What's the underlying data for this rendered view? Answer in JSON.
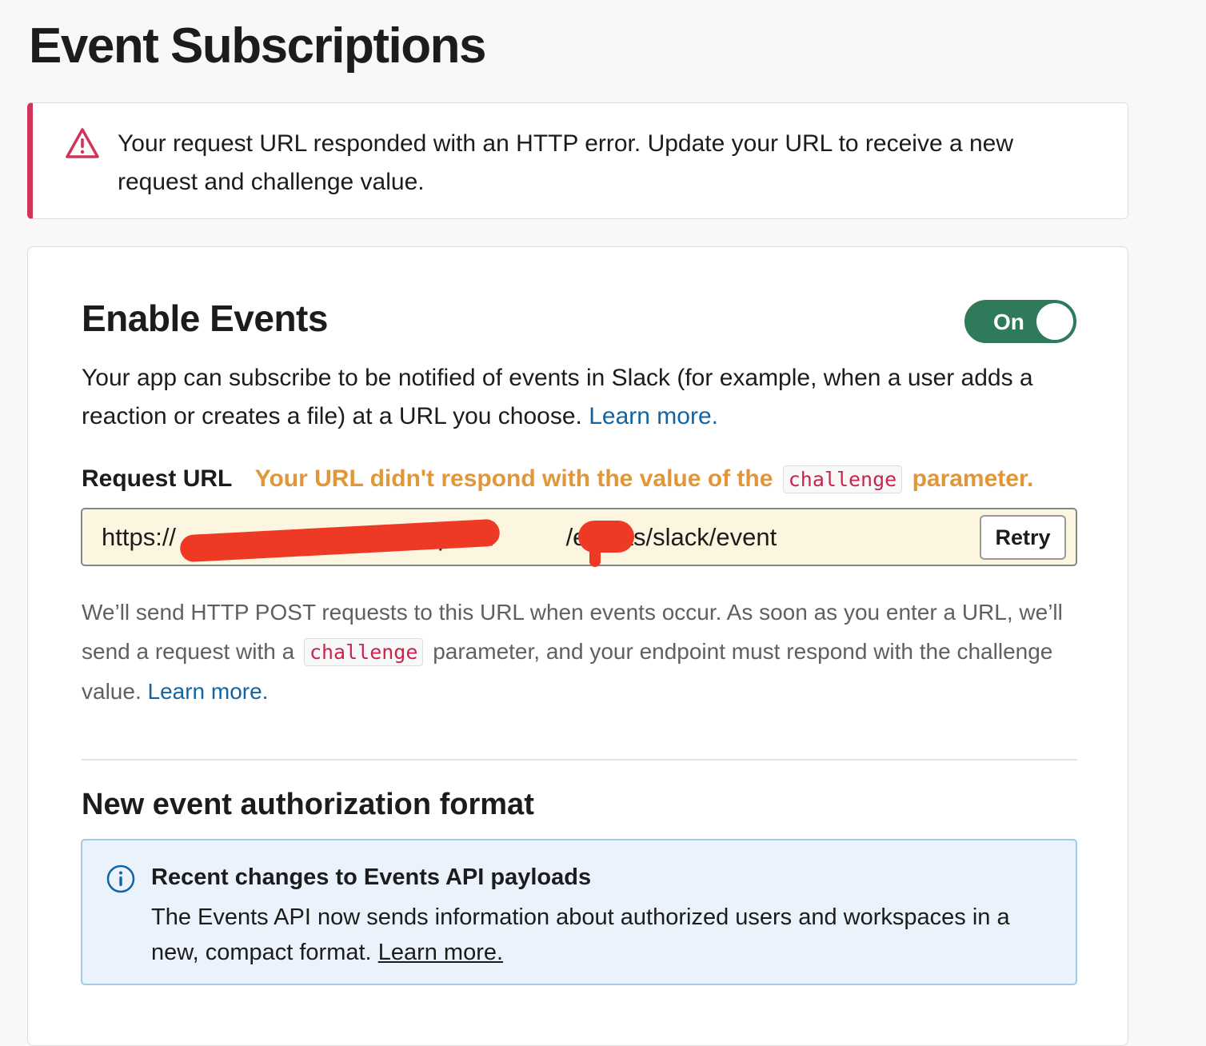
{
  "page": {
    "title": "Event Subscriptions"
  },
  "alert": {
    "icon": "warning-triangle-icon",
    "message": "Your request URL responded with an HTTP error. Update your URL to receive a new request and challenge value.",
    "color": "#d1345b"
  },
  "enable_events": {
    "title": "Enable Events",
    "toggle_label": "On",
    "toggle_state": "on",
    "description": "Your app can subscribe to be notified of events in Slack (for example, when a user adds a reaction or creates a file) at a URL you choose.",
    "learn_more": "Learn more.",
    "accent_color": "#2f7a5b"
  },
  "request_url": {
    "label": "Request URL",
    "error_prefix": "Your URL didn't respond with the value of the",
    "error_code": "challenge",
    "error_suffix": "parameter.",
    "value": "https://                                   /api/v1/          /events/slack/event",
    "retry_label": "Retry",
    "help_prefix": "We’ll send HTTP POST requests to this URL when events occur. As soon as you enter a URL, we’ll send a request with a",
    "help_code": "challenge",
    "help_suffix": "parameter, and your endpoint must respond with the challenge value.",
    "help_learn_more": "Learn more."
  },
  "authorization": {
    "title": "New event authorization format",
    "info_icon": "info-circle-icon",
    "info_title": "Recent changes to Events API payloads",
    "info_body": "The Events API now sends information about authorized users and workspaces in a new, compact format.",
    "info_learn_more": "Learn more."
  }
}
